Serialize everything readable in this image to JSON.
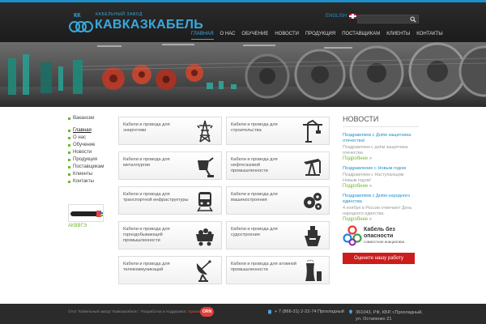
{
  "colors": {
    "accent": "#1e8fc9",
    "green": "#6fb829",
    "red": "#cc1c1c",
    "header_bg": "#232323"
  },
  "header": {
    "logo_sub": "КАБЕЛЬНЫЙ ЗАВОД",
    "logo_name": "КАВКАЗКАБЕЛЬ",
    "lang_label": "ENGLISH",
    "search_placeholder": "",
    "nav": [
      "ГЛАВНАЯ",
      "О НАС",
      "ОБУЧЕНИЕ",
      "НОВОСТИ",
      "ПРОДУКЦИЯ",
      "ПОСТАВЩИКАМ",
      "КЛИЕНТЫ",
      "КОНТАКТЫ"
    ],
    "active_nav": "ГЛАВНАЯ"
  },
  "sidebar": {
    "items": [
      "Вакансии",
      "Главная",
      "О нас",
      "Обучение",
      "Новости",
      "Продукция",
      "Поставщикам",
      "Клиенты",
      "Контакты"
    ],
    "active": "Главная",
    "cable_caption": "АКВВГЭ"
  },
  "products": [
    {
      "label": "Кабели и провода для энергетики",
      "icon": "power-tower-icon"
    },
    {
      "label": "Кабели и провода для строительства",
      "icon": "crane-icon"
    },
    {
      "label": "Кабели и провода для металлургии",
      "icon": "ladle-icon"
    },
    {
      "label": "Кабели и провода для нефтегазовой промышленности",
      "icon": "oil-pump-icon"
    },
    {
      "label": "Кабели и провода для транспортной инфраструктуры",
      "icon": "train-icon"
    },
    {
      "label": "Кабели и провода для машиностроения",
      "icon": "gears-icon"
    },
    {
      "label": "Кабели и провода для горнодобывающей промышленности",
      "icon": "mine-cart-icon"
    },
    {
      "label": "Кабели и провода для судостроения",
      "icon": "ship-icon"
    },
    {
      "label": "Кабели и провода для телекоммуникаций",
      "icon": "satellite-dish-icon"
    },
    {
      "label": "Кабели и провода для атомной промышленности",
      "icon": "nuclear-plant-icon"
    }
  ],
  "news": {
    "title": "НОВОСТИ",
    "items": [
      {
        "title": "Поздравляем с Днём защитника отечества!",
        "text": "Поздравляем с днём защитника отечества",
        "more": "Подробнее »"
      },
      {
        "title": "Поздравление с Новым годом",
        "text": "Поздравляем с Наступающим Новым годом!",
        "more": "Подробнее »"
      },
      {
        "title": "Поздравляем с Днём народного единства",
        "text": "4 ноября в России отмечают День народного единства.",
        "more": "Подробнее »"
      }
    ]
  },
  "safety": {
    "title": "Кабель без опасности",
    "subtitle": "совместная инициатива"
  },
  "rate_button": "Оцените нашу работу",
  "footer": {
    "copyright": "©АО \"Кабельный завод \"Кавказкабель\". Разработка и поддержка:",
    "developer": "Оранж",
    "footer_logo": "ORN",
    "phone": "+ 7 (866-31) 2-22-74 Прохладный",
    "address_line1": "361043, РФ, КБР, г.Прохладный,",
    "address_line2": "ул. Остапенко 21"
  }
}
